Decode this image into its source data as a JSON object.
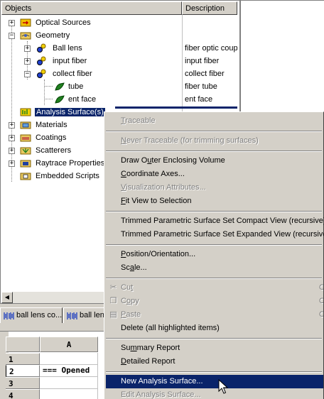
{
  "tree": {
    "header": {
      "objects": "Objects",
      "description": "Description"
    },
    "items": [
      {
        "label": "Optical Sources",
        "desc": ""
      },
      {
        "label": "Geometry",
        "desc": ""
      },
      {
        "label": "Ball lens",
        "desc": "fiber optic coup"
      },
      {
        "label": "input fiber",
        "desc": "input fiber"
      },
      {
        "label": "collect fiber",
        "desc": "collect fiber"
      },
      {
        "label": "tube",
        "desc": "fiber tube"
      },
      {
        "label": "ent face",
        "desc": "ent face"
      },
      {
        "label": "Analysis Surface(s)",
        "desc": ""
      },
      {
        "label": "Materials",
        "desc": ""
      },
      {
        "label": "Coatings",
        "desc": ""
      },
      {
        "label": "Scatterers",
        "desc": ""
      },
      {
        "label": "Raytrace Properties",
        "desc": ""
      },
      {
        "label": "Embedded Scripts",
        "desc": ""
      }
    ]
  },
  "tabs": [
    {
      "label": "ball lens co..."
    },
    {
      "label": "ball lens"
    }
  ],
  "sheet": {
    "col_header": "A",
    "rows": [
      {
        "num": "1",
        "cell": ""
      },
      {
        "num": "2",
        "cell": "=== Opened"
      },
      {
        "num": "3",
        "cell": ""
      },
      {
        "num": "4",
        "cell": ""
      }
    ]
  },
  "menu": {
    "traceable": {
      "pre": "",
      "u": "T",
      "post": "raceable"
    },
    "never_traceable": {
      "pre": "",
      "u": "N",
      "post": "ever Traceable (for trimming surfaces)"
    },
    "draw_outer": {
      "pre": "Draw O",
      "u": "u",
      "post": "ter Enclosing Volume"
    },
    "coord_axes": {
      "pre": "",
      "u": "C",
      "post": "oordinate Axes..."
    },
    "vis_attr": {
      "pre": "",
      "u": "V",
      "post": "isualization Attributes..."
    },
    "fit_view": {
      "pre": "",
      "u": "F",
      "post": "it View to Selection"
    },
    "trim_compact": "Trimmed Parametric Surface Set Compact View (recursive)",
    "trim_expanded": "Trimmed Parametric Surface Set Expanded View (recursive)",
    "position": {
      "pre": "",
      "u": "P",
      "post": "osition/Orientation..."
    },
    "scale": {
      "pre": "Sc",
      "u": "a",
      "post": "le..."
    },
    "cut": {
      "pre": "Cu",
      "u": "t",
      "post": ""
    },
    "copy": {
      "pre": "C",
      "u": "o",
      "post": "py"
    },
    "paste": {
      "pre": "",
      "u": "P",
      "post": "aste"
    },
    "delete": "Delete (all highlighted items)",
    "summary": {
      "pre": "Su",
      "u": "m",
      "post": "mary Report"
    },
    "detailed": {
      "pre": "",
      "u": "D",
      "post": "etailed Report"
    },
    "new_analysis": "New Analysis Surface...",
    "edit_analysis": "Edit Analysis Surface..."
  },
  "colors": {
    "selection": "#0a246a",
    "face": "#d4d0c8"
  }
}
